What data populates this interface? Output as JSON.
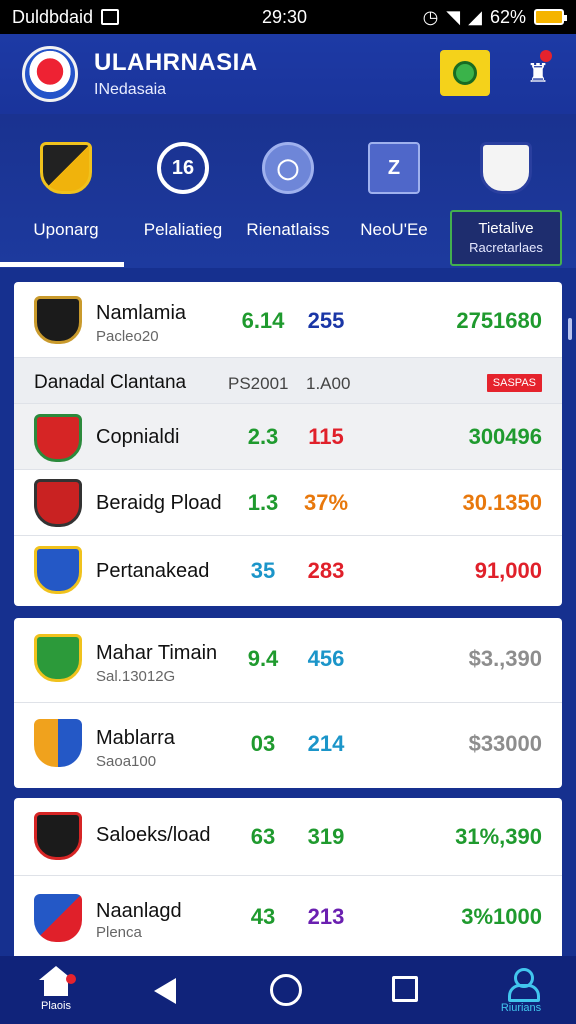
{
  "status_bar": {
    "left_text": "Duldbdaid",
    "time": "29:30",
    "battery": "62%"
  },
  "header": {
    "title": "ULAHRNASIA",
    "subtitle": "INedasaia"
  },
  "categories": [
    {
      "label": "Uponarg",
      "icon": "shield-icon"
    },
    {
      "label": "Pelaliatieg",
      "icon": "number-16-icon"
    },
    {
      "label": "Rienatlaiss",
      "icon": "chat-circle-icon"
    },
    {
      "label": "NeoU'Ee",
      "icon": "puzzle-icon"
    }
  ],
  "category_last": {
    "label": "Tietalive",
    "sub": "Racretarlaes"
  },
  "card1": {
    "top_row": {
      "name": "Namlamia",
      "sub": "Pacleo20",
      "v1": "6.14",
      "v2": "255",
      "v3": "2751680"
    },
    "header_row": {
      "name": "Danadal Clantana",
      "c1": "PS2001",
      "c2": "1.A00",
      "badge": "SASPAS"
    },
    "rows": [
      {
        "name": "Copnialdi",
        "v1": "2.3",
        "v2": "115",
        "v3": "300496"
      },
      {
        "name": "Beraidg Pload",
        "v1": "1.3",
        "v2": "37%",
        "v3": "30.1350"
      },
      {
        "name": "Pertanakead",
        "v1": "35",
        "v2": "283",
        "v3": "91,000"
      }
    ]
  },
  "card2": {
    "rows": [
      {
        "name": "Mahar Timain",
        "sub": "Sal.13012G",
        "v1": "9.4",
        "v2": "456",
        "v3": "$3.,390"
      },
      {
        "name": "Mablarra",
        "sub": "Saoa100",
        "v1": "03",
        "v2": "214",
        "v3": "$33000"
      }
    ]
  },
  "card3": {
    "rows": [
      {
        "name": "Saloeks/load",
        "v1": "63",
        "v2": "319",
        "v3": "31%,390"
      },
      {
        "name": "Naanlagd",
        "sub": "Plenca",
        "v1": "43",
        "v2": "213",
        "v3": "3%1000"
      }
    ]
  },
  "nav": {
    "home_label": "Plaois",
    "profile_label": "Riurians"
  },
  "colors": {
    "green": "#1f9a2e",
    "blue": "#1a36a6",
    "red": "#e0202a",
    "orange": "#e8780c",
    "cyan": "#1b95c9",
    "gray": "#8d8d8d",
    "purple": "#6a1fb0",
    "primary": "#16308f"
  }
}
